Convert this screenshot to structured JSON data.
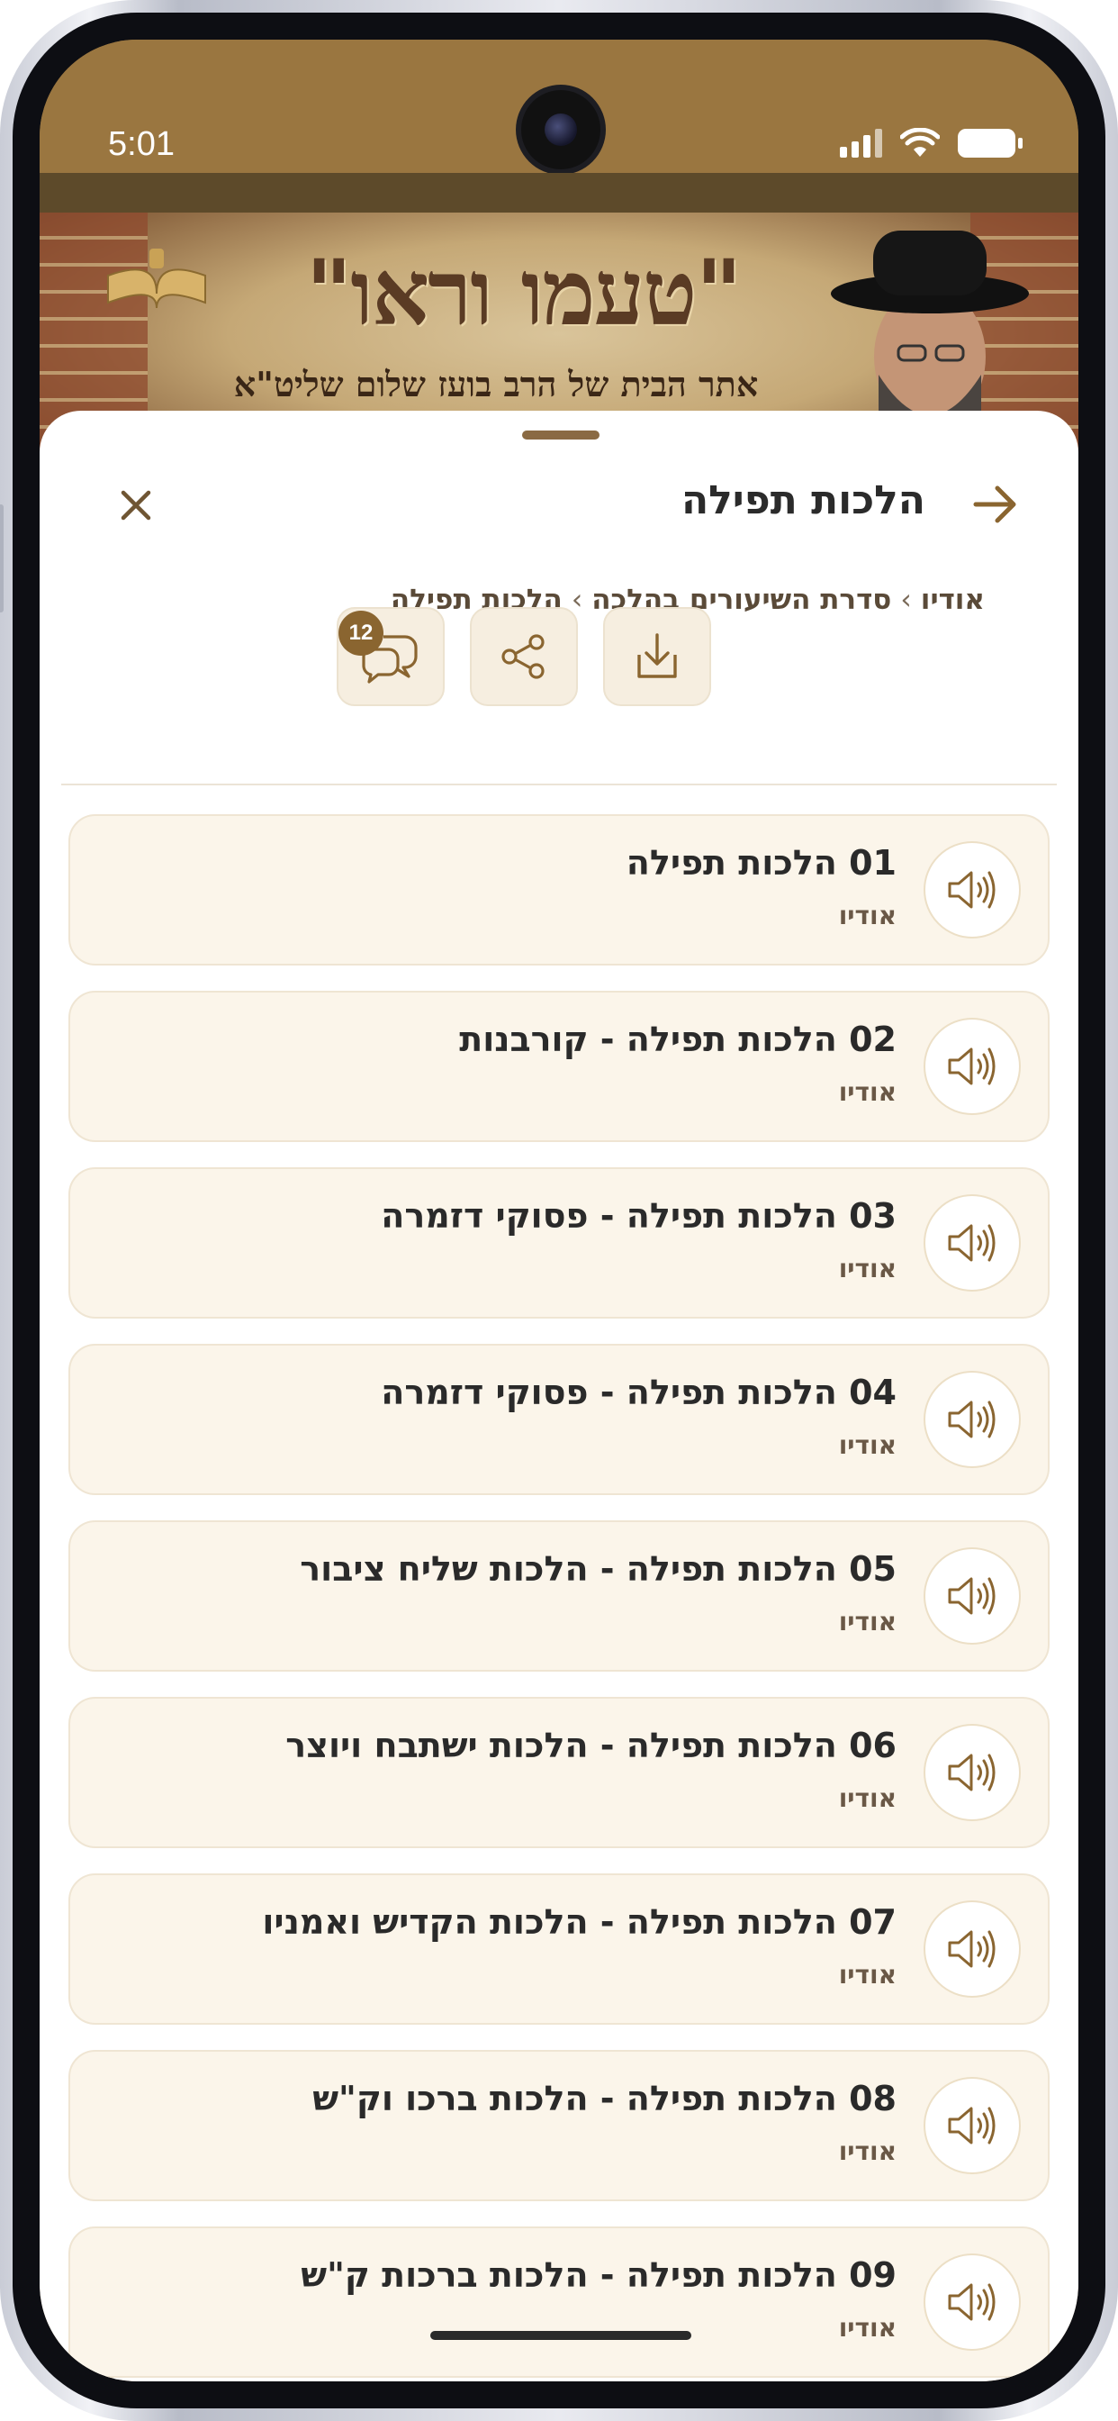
{
  "status_bar": {
    "time": "5:01"
  },
  "banner": {
    "title": "\"טעמו וראו\"",
    "subtitle": "אתר הבית של הרב בועז שלום שליט\"א"
  },
  "sheet": {
    "title": "הלכות תפילה",
    "breadcrumb": [
      "אודיו",
      "סדרת השיעורים בהלכה",
      "הלכות תפילה"
    ],
    "breadcrumb_sep": "›",
    "comments_count": "12"
  },
  "colors": {
    "accent": "#8a6530",
    "card_bg": "#fbf5ea",
    "card_border": "#efe5d3"
  },
  "items": [
    {
      "title": "01 הלכות תפילה",
      "type": "אודיו",
      "icon": "speaker-icon"
    },
    {
      "title": "02 הלכות תפילה - קורבנות",
      "type": "אודיו",
      "icon": "speaker-icon"
    },
    {
      "title": "03 הלכות תפילה - פסוקי דזמרה",
      "type": "אודיו",
      "icon": "speaker-icon"
    },
    {
      "title": "04 הלכות תפילה - פסוקי דזמרה",
      "type": "אודיו",
      "icon": "speaker-icon"
    },
    {
      "title": "05 הלכות תפילה - הלכות שליח ציבור",
      "type": "אודיו",
      "icon": "speaker-icon"
    },
    {
      "title": "06 הלכות תפילה - הלכות ישתבח ויוצר",
      "type": "אודיו",
      "icon": "speaker-icon"
    },
    {
      "title": "07 הלכות תפילה - הלכות הקדיש ואמניו",
      "type": "אודיו",
      "icon": "speaker-icon"
    },
    {
      "title": "08 הלכות תפילה - הלכות ברכו וק\"ש",
      "type": "אודיו",
      "icon": "speaker-icon"
    },
    {
      "title": "09 הלכות תפילה - הלכות ברכות ק\"ש",
      "type": "אודיו",
      "icon": "speaker-icon"
    }
  ]
}
